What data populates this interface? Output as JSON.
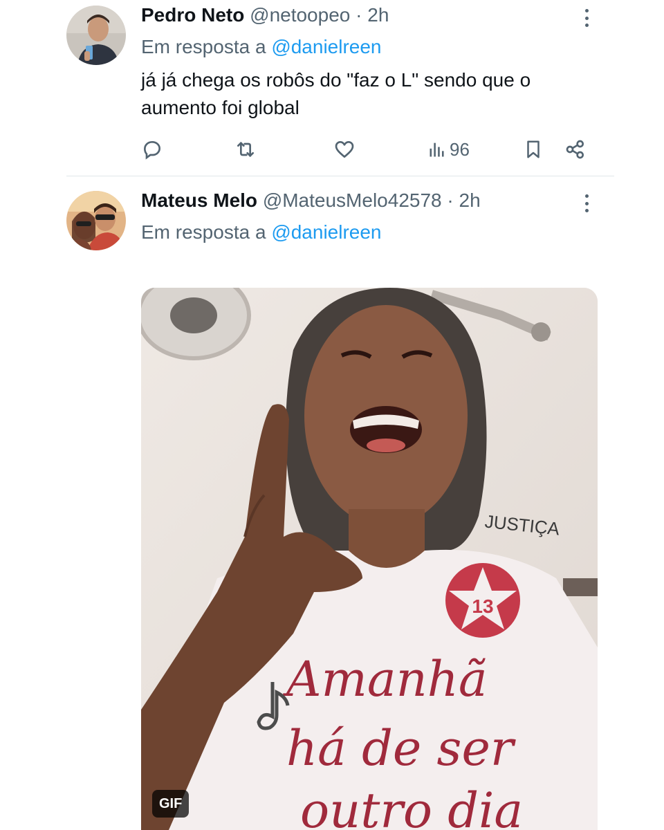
{
  "tweets": [
    {
      "display_name": "Pedro Neto",
      "handle": "@netoopeo",
      "separator": "·",
      "time": "2h",
      "reply_prefix": "Em resposta a",
      "reply_to": "@danielreen",
      "text": "já já chega os robôs do \"faz o L\" sendo que o aumento foi global",
      "actions": {
        "reply_icon": "reply-icon",
        "retweet_icon": "retweet-icon",
        "like_icon": "heart-icon",
        "views_icon": "views-icon",
        "views_count": "96",
        "bookmark_icon": "bookmark-icon",
        "share_icon": "share-icon"
      }
    },
    {
      "display_name": "Mateus Melo",
      "handle": "@MateusMelo42578",
      "separator": "·",
      "time": "2h",
      "reply_prefix": "Em resposta a",
      "reply_to": "@danielreen",
      "media": {
        "type": "gif",
        "badge": "GIF",
        "shirt_text": [
          "Amanhã",
          "há de ser",
          "outro dia"
        ],
        "badge_number": "13",
        "background_text": "JUSTIÇA"
      }
    }
  ],
  "colors": {
    "accent": "#1d9bf0",
    "secondary_text": "#536471",
    "primary_text": "#0f1419",
    "divider": "#e1e6ea"
  }
}
